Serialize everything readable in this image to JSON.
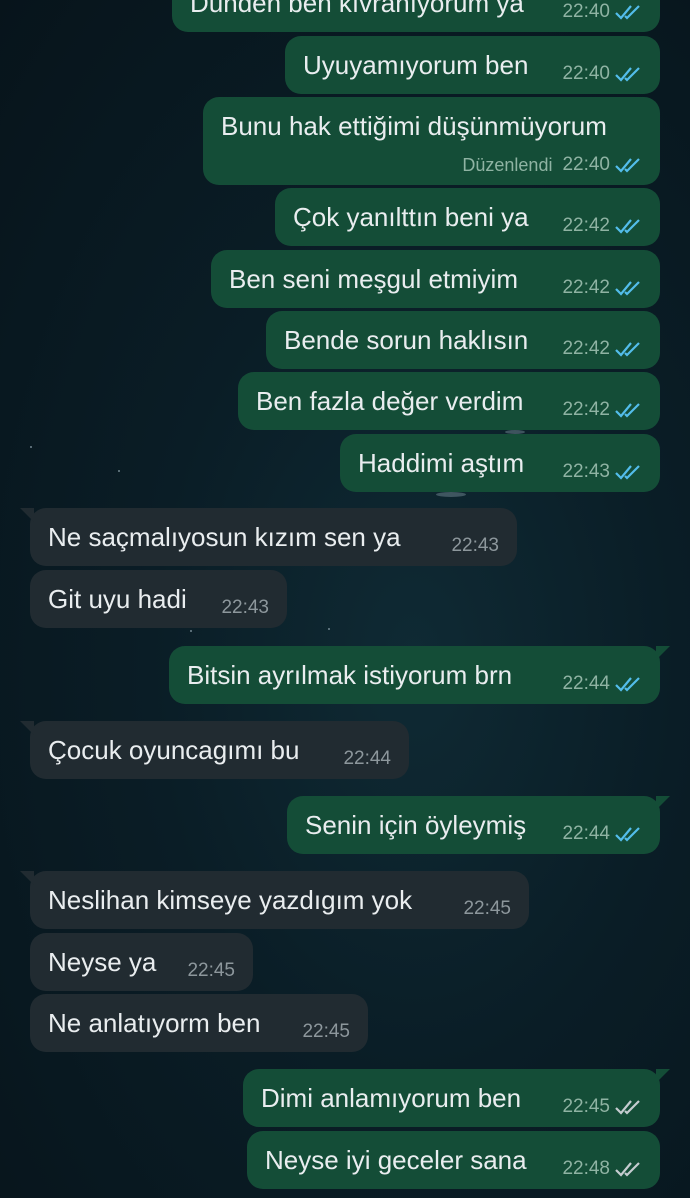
{
  "messages": [
    {
      "dir": "out",
      "text": "Dünden ben kıvranıyorum ya",
      "time": "22:40",
      "status": "read"
    },
    {
      "dir": "out",
      "text": "Uyuyamıyorum ben",
      "time": "22:40",
      "status": "read"
    },
    {
      "dir": "out",
      "text": "Bunu hak ettiğimi düşünmüyorum",
      "edited_label": "Düzenlendi",
      "time": "22:40",
      "status": "read"
    },
    {
      "dir": "out",
      "text": "Çok yanılttın beni ya",
      "time": "22:42",
      "status": "read"
    },
    {
      "dir": "out",
      "text": "Ben seni meşgul etmiyim",
      "time": "22:42",
      "status": "read"
    },
    {
      "dir": "out",
      "text": "Bende sorun haklısın",
      "time": "22:42",
      "status": "read"
    },
    {
      "dir": "out",
      "text": "Ben fazla değer verdim",
      "time": "22:42",
      "status": "read"
    },
    {
      "dir": "out",
      "text": "Haddimi aştım",
      "time": "22:43",
      "status": "read"
    },
    {
      "dir": "in",
      "text": "Ne saçmalıyosun kızım sen ya",
      "time": "22:43"
    },
    {
      "dir": "in",
      "text": "Git uyu hadi",
      "time": "22:43"
    },
    {
      "dir": "out",
      "text": "Bitsin ayrılmak istiyorum brn",
      "time": "22:44",
      "status": "read"
    },
    {
      "dir": "in",
      "text": "Çocuk oyuncagımı bu",
      "time": "22:44"
    },
    {
      "dir": "out",
      "text": "Senin için öyleymiş",
      "time": "22:44",
      "status": "read"
    },
    {
      "dir": "in",
      "text": "Neslihan kimseye yazdıgım yok",
      "time": "22:45"
    },
    {
      "dir": "in",
      "text": "Neyse ya",
      "time": "22:45"
    },
    {
      "dir": "in",
      "text": "Ne anlatıyorm ben",
      "time": "22:45"
    },
    {
      "dir": "out",
      "text": "Dimi anlamıyorum ben",
      "time": "22:45",
      "status": "delivered"
    },
    {
      "dir": "out",
      "text": "Neyse iyi geceler sana",
      "time": "22:48",
      "status": "delivered"
    }
  ],
  "colors": {
    "outgoing_bubble": "#144d37",
    "incoming_bubble": "#212b31",
    "read_ticks": "#53bdeb",
    "delivered_ticks": "#c5ccd0"
  }
}
